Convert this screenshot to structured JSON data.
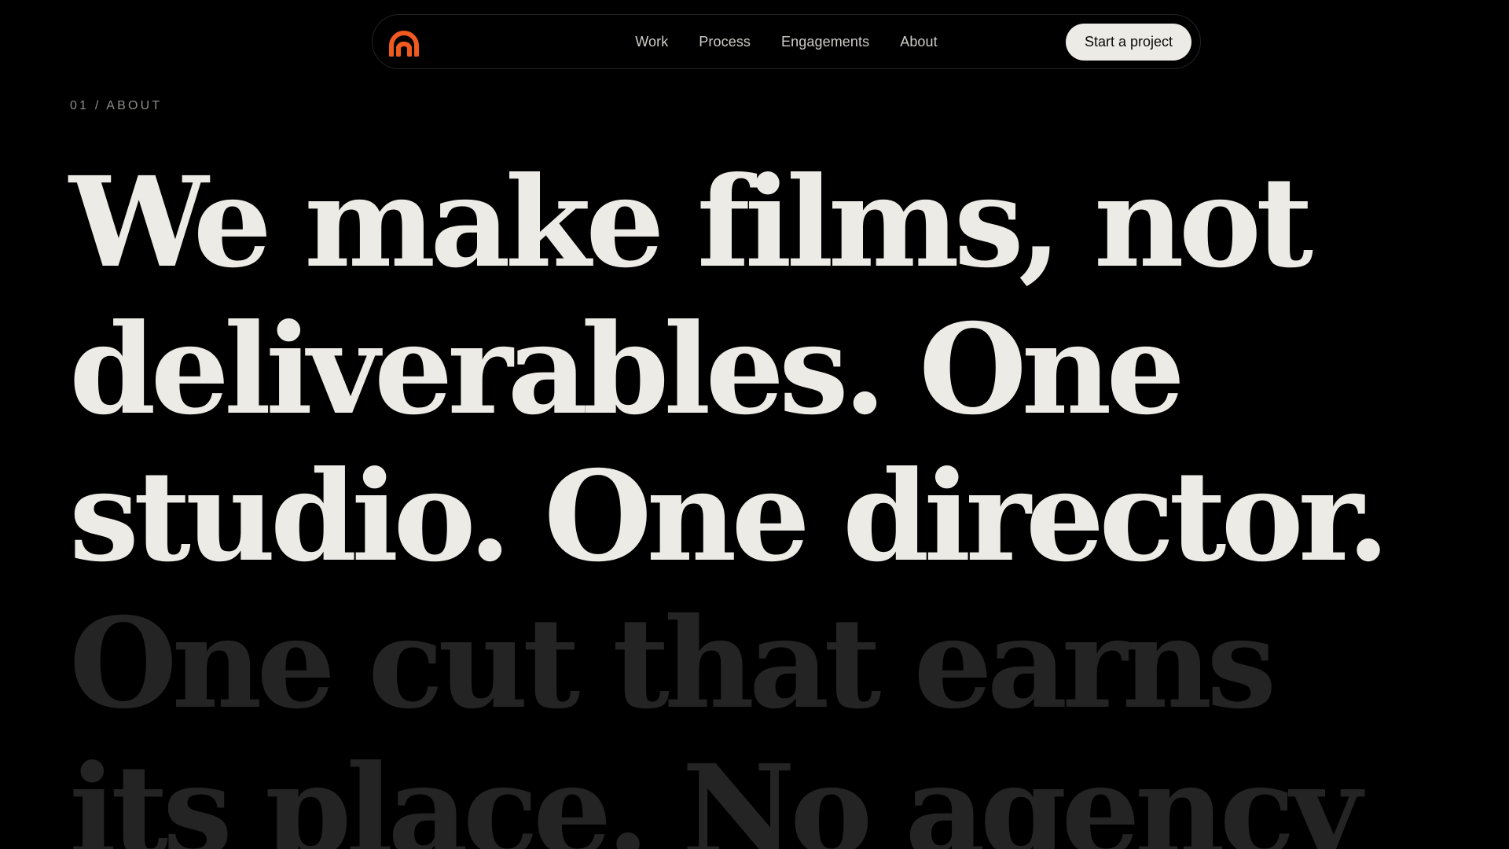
{
  "nav": {
    "logo_name": "studio-logo",
    "brand_color": "#f05a1e",
    "links": [
      {
        "label": "Work"
      },
      {
        "label": "Process"
      },
      {
        "label": "Engagements"
      },
      {
        "label": "About"
      }
    ],
    "cta_label": "Start a project"
  },
  "section": {
    "eyebrow": "01 / ABOUT"
  },
  "headline": {
    "lines": [
      {
        "text": "We make films, not",
        "tone": "bright"
      },
      {
        "text": "deliverables. One",
        "tone": "bright"
      },
      {
        "text": "studio. One director.",
        "tone": "bright"
      },
      {
        "text": "One cut that earns",
        "tone": "dim"
      },
      {
        "text": "its place. No agency",
        "tone": "dim"
      }
    ]
  },
  "colors": {
    "background": "#000000",
    "text_primary": "#ecebe6",
    "text_dim": "#242424",
    "nav_border": "#232323",
    "accent": "#f05a1e"
  }
}
